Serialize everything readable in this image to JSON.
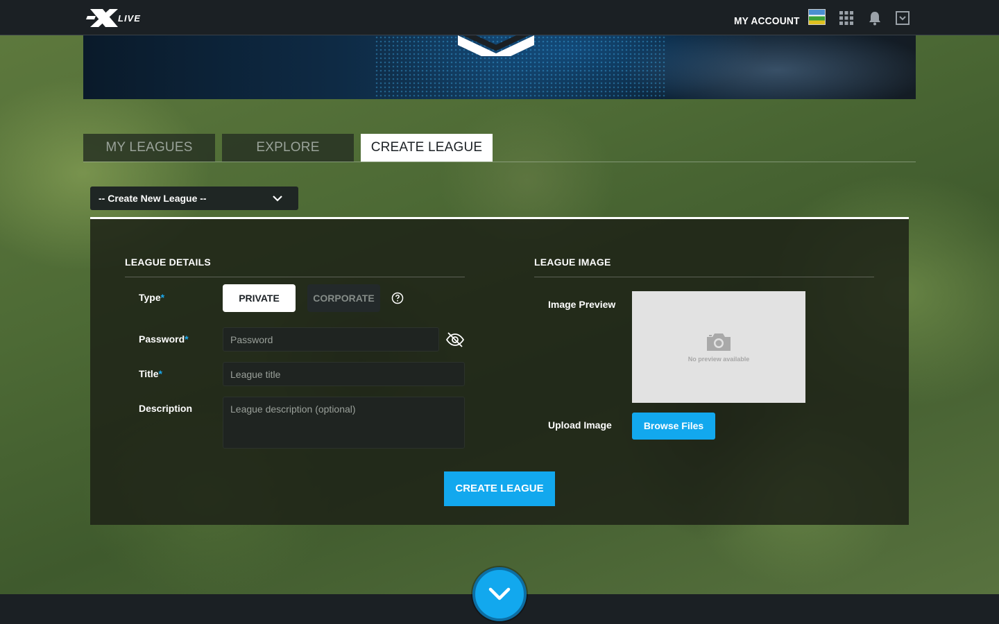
{
  "header": {
    "logo_text": "FSXLIVE",
    "my_account_label": "MY ACCOUNT",
    "icons": [
      "flag-icon",
      "apps-grid-icon",
      "bell-icon",
      "dropdown-box-icon"
    ]
  },
  "tabs": [
    {
      "label": "MY LEAGUES",
      "active": false
    },
    {
      "label": "EXPLORE",
      "active": false
    },
    {
      "label": "CREATE LEAGUE",
      "active": true
    }
  ],
  "league_select": {
    "selected": "-- Create New League --"
  },
  "league_details": {
    "title": "LEAGUE DETAILS",
    "type_label": "Type",
    "type_options": [
      "PRIVATE",
      "CORPORATE"
    ],
    "type_selected": "PRIVATE",
    "password_label": "Password",
    "password_placeholder": "Password",
    "title_label": "Title",
    "title_placeholder": "League title",
    "description_label": "Description",
    "description_placeholder": "League description (optional)",
    "required_mark": "*"
  },
  "league_image": {
    "title": "LEAGUE IMAGE",
    "preview_label": "Image Preview",
    "no_preview_text": "No preview available",
    "upload_label": "Upload Image",
    "browse_button": "Browse Files"
  },
  "create_button": "CREATE LEAGUE",
  "colors": {
    "accent": "#12a8ee",
    "topbar": "#1b2024",
    "panel": "#1c2016"
  }
}
